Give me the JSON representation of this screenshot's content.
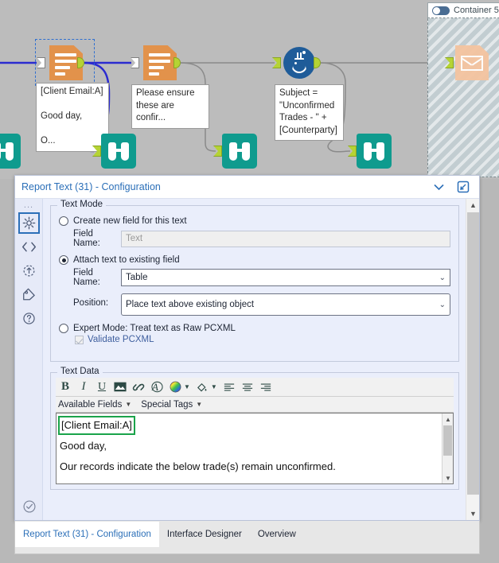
{
  "canvas": {
    "container": {
      "label": "Container 5",
      "toggle_on": true
    },
    "nodes": [
      {
        "id": "report-text-1",
        "type": "report-text-icon",
        "annotation": "[Client Email:A]\n\nGood day,\n\nO...",
        "selected": true
      },
      {
        "id": "report-text-2",
        "type": "report-text-icon",
        "annotation": "Please ensure\nthese are confir..."
      },
      {
        "id": "formula-1",
        "type": "formula-icon",
        "annotation": "Subject =\n\"Unconfirmed\nTrades - \" +\n[Counterparty]"
      },
      {
        "id": "email-1",
        "type": "email-icon",
        "annotation": ""
      },
      {
        "id": "browse-1",
        "type": "browse-icon",
        "annotation": ""
      },
      {
        "id": "browse-2",
        "type": "browse-icon",
        "annotation": ""
      },
      {
        "id": "browse-3",
        "type": "browse-icon",
        "annotation": ""
      },
      {
        "id": "browse-4",
        "type": "browse-icon",
        "annotation": ""
      }
    ]
  },
  "config_panel": {
    "title": "Report Text (31) - Configuration",
    "rail": {
      "dots": "...",
      "items": [
        {
          "name": "configuration",
          "icon": "gear-icon",
          "active": true
        },
        {
          "name": "xml-view",
          "icon": "code-icon",
          "active": false
        },
        {
          "name": "run-tool",
          "icon": "arrow-circle-icon",
          "active": false
        },
        {
          "name": "annotation",
          "icon": "tag-icon",
          "active": false
        },
        {
          "name": "help",
          "icon": "question-circle-icon",
          "active": false
        }
      ],
      "bottom_icon": "check-circle-icon"
    },
    "text_mode": {
      "legend": "Text Mode",
      "option_create": {
        "label": "Create new field for this text",
        "selected": false
      },
      "create_field_name_label": "Field Name:",
      "create_field_name_placeholder": "Text",
      "create_field_name_value": "",
      "option_attach": {
        "label": "Attach text to existing field",
        "selected": true
      },
      "attach_field_name_label": "Field Name:",
      "attach_field_name_value": "Table",
      "position_label": "Position:",
      "position_value": "Place text above existing object",
      "option_expert": {
        "label": "Expert Mode: Treat text as Raw PCXML",
        "selected": false
      },
      "validate_pcxml": {
        "label": "Validate PCXML",
        "checked": true
      }
    },
    "text_data": {
      "legend": "Text Data",
      "toolbar": [
        {
          "name": "bold-icon",
          "glyph": "B"
        },
        {
          "name": "italic-icon",
          "glyph": "I"
        },
        {
          "name": "underline-icon",
          "glyph": "U"
        },
        {
          "name": "image-icon",
          "glyph": "▤"
        },
        {
          "name": "link-icon",
          "glyph": "🔗"
        },
        {
          "name": "font-icon",
          "glyph": "A"
        },
        {
          "name": "text-color-icon",
          "glyph": "●"
        },
        {
          "name": "fill-color-icon",
          "glyph": "◔"
        },
        {
          "name": "align-left-icon",
          "glyph": "≡"
        },
        {
          "name": "align-center-icon",
          "glyph": "≡"
        },
        {
          "name": "align-right-icon",
          "glyph": "≡"
        }
      ],
      "menus": [
        {
          "name": "available-fields-menu",
          "label": "Available Fields"
        },
        {
          "name": "special-tags-menu",
          "label": "Special Tags"
        }
      ],
      "editor_lines": [
        "[Client Email:A]",
        "Good day,",
        "Our records indicate the below trade(s) remain unconfirmed."
      ],
      "highlighted_line": "[Client Email:A]",
      "highlight_color": "#1aa34a"
    }
  },
  "tabs": [
    {
      "label": "Report Text (31) - Configuration",
      "active": true
    },
    {
      "label": "Interface Designer",
      "active": false
    },
    {
      "label": "Overview",
      "active": false
    }
  ]
}
